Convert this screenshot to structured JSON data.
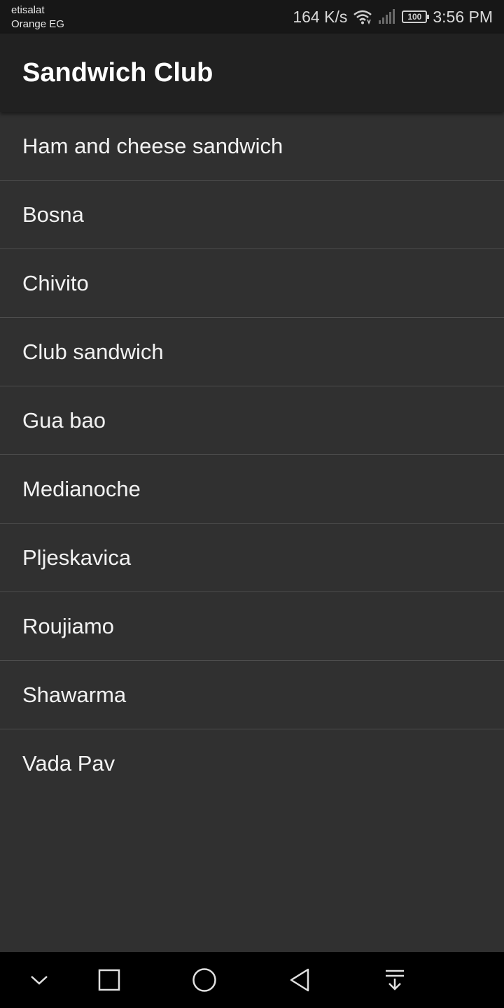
{
  "status_bar": {
    "carrier_line1": "etisalat",
    "carrier_line2": "Orange EG",
    "network_speed": "164 K/s",
    "battery_level": "100",
    "time": "3:56 PM",
    "icons": [
      "wifi-icon",
      "signal-icon",
      "battery-icon"
    ]
  },
  "app_bar": {
    "title": "Sandwich Club"
  },
  "sandwiches": [
    "Ham and cheese sandwich",
    "Bosna",
    "Chivito",
    "Club sandwich",
    "Gua bao",
    "Medianoche",
    "Pljeskavica",
    "Roujiamo",
    "Shawarma",
    "Vada Pav"
  ],
  "nav_bar": {
    "icons": [
      "hide-nav-icon",
      "recents-icon",
      "home-icon",
      "back-icon",
      "notifications-pull-icon"
    ]
  },
  "colors": {
    "background": "#303030",
    "app_bar": "#212121",
    "status_bar": "#171717",
    "nav_bar": "#000000",
    "divider": "#4d4d4d"
  }
}
